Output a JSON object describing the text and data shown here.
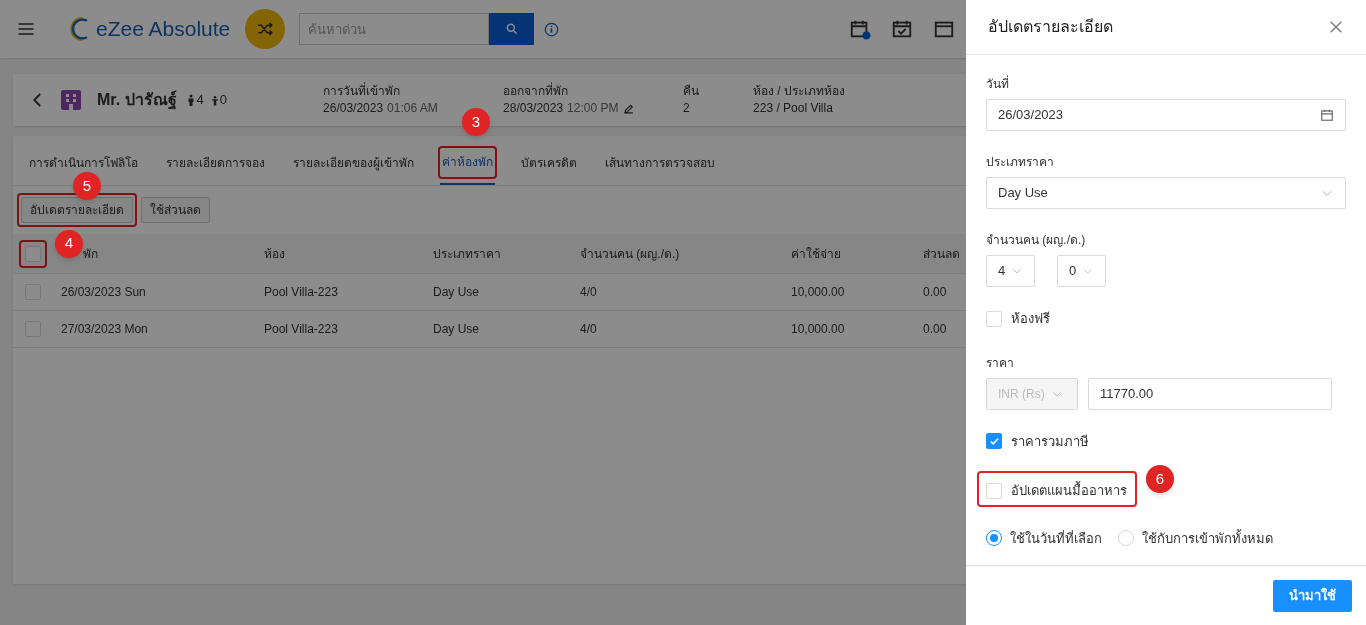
{
  "topbar": {
    "brand": "eZee Absolute",
    "search": {
      "placeholder": "ค้นหาด่วน"
    }
  },
  "guest": {
    "name": "Mr. ปารัณฐ์",
    "adults": "4",
    "children": "0",
    "fields": [
      {
        "kind": "datetime",
        "label": "การวันที่เข้าพัก",
        "date": "26/03/2023",
        "time": "01:06 AM",
        "editable": false
      },
      {
        "kind": "datetime",
        "label": "ออกจากที่พัก",
        "date": "28/03/2023",
        "time": "12:00 PM",
        "editable": true
      },
      {
        "kind": "plain",
        "label": "คืน",
        "value": "2"
      },
      {
        "kind": "plain",
        "label": "ห้อง / ประเภทห้อง",
        "value": "223 / Pool Villa"
      }
    ]
  },
  "tabs": [
    {
      "label": "การดำเนินการโฟลิโอ",
      "selected": false
    },
    {
      "label": "รายละเอียดการจอง",
      "selected": false
    },
    {
      "label": "รายละเอียดของผู้เข้าพัก",
      "selected": false
    },
    {
      "label": "ค่าห้องพัก",
      "selected": true,
      "highlighted": true,
      "callout": "3"
    },
    {
      "label": "บัตรเครดิต",
      "selected": false
    },
    {
      "label": "เส้นทางการตรวจสอบ",
      "selected": false
    }
  ],
  "actions": [
    {
      "label": "อัปเดตรายละเอียด",
      "highlighted": true,
      "callout": "5"
    },
    {
      "label": "ใช้ส่วนลด",
      "highlighted": false
    }
  ],
  "table": {
    "select_all": {
      "checked": false,
      "highlighted": true,
      "callout": "4"
    },
    "columns": [
      "พัก",
      "ห้อง",
      "ประเภทราคา",
      "จำนวนคน (ผญ./ด.)",
      "ค่าใช้จ่าย",
      "ส่วนลด"
    ],
    "rows": [
      {
        "checked": false,
        "cells": [
          "26/03/2023 Sun",
          "Pool Villa-223",
          "Day Use",
          "4/0",
          "10,000.00",
          "0.00"
        ]
      },
      {
        "checked": false,
        "cells": [
          "27/03/2023 Mon",
          "Pool Villa-223",
          "Day Use",
          "4/0",
          "10,000.00",
          "0.00"
        ]
      }
    ]
  },
  "drawer": {
    "title": "อัปเดตรายละเอียด",
    "date": {
      "label": "วันที่",
      "value": "26/03/2023"
    },
    "rate_type": {
      "label": "ประเภทราคา",
      "value": "Day Use"
    },
    "pax": {
      "label": "จำนวนคน (ผญ./ด.)",
      "adults": "4",
      "children": "0"
    },
    "complimentary": {
      "label": "ห้องฟรี",
      "checked": false
    },
    "rate": {
      "label": "ราคา",
      "currency": "INR (Rs)",
      "currency_disabled": true,
      "value": "11770.00"
    },
    "tax_inclusive": {
      "label": "ราคารวมภาษี",
      "checked": true
    },
    "update_meal_plan": {
      "label": "อัปเดตแผนมื้ออาหาร",
      "checked": false,
      "highlighted": true,
      "callout": "6"
    },
    "apply_to": [
      {
        "label": "ใช้ในวันที่ที่เลือก",
        "selected": true
      },
      {
        "label": "ใช้กับการเข้าพักทั้งหมด",
        "selected": false
      }
    ],
    "apply_button": "นำมาใช้"
  }
}
